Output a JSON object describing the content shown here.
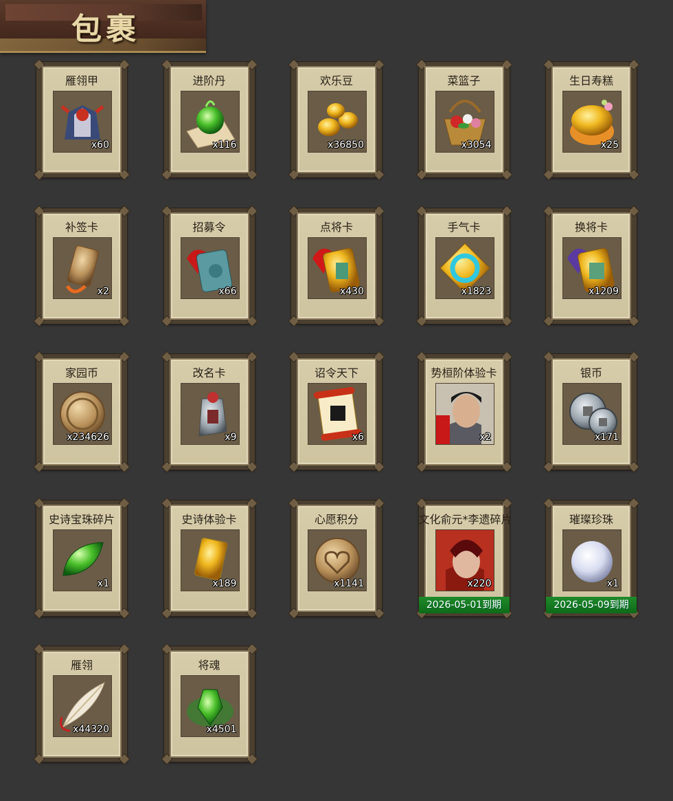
{
  "header": {
    "title": "包裹"
  },
  "items": [
    {
      "name": "雁翎甲",
      "qty": "x60",
      "icon": "armor-icon",
      "expire": ""
    },
    {
      "name": "进阶丹",
      "qty": "x116",
      "icon": "green-pill-icon",
      "expire": ""
    },
    {
      "name": "欢乐豆",
      "qty": "x36850",
      "icon": "gold-beans-icon",
      "expire": ""
    },
    {
      "name": "菜篮子",
      "qty": "x3054",
      "icon": "flower-basket-icon",
      "expire": ""
    },
    {
      "name": "生日寿糕",
      "qty": "x25",
      "icon": "birthday-cake-icon",
      "expire": ""
    },
    {
      "name": "补签卡",
      "qty": "x2",
      "icon": "bronze-tag-icon",
      "expire": ""
    },
    {
      "name": "招募令",
      "qty": "x66",
      "icon": "recruit-token-icon",
      "expire": ""
    },
    {
      "name": "点将卡",
      "qty": "x430",
      "icon": "general-card-icon",
      "expire": ""
    },
    {
      "name": "手气卡",
      "qty": "x1823",
      "icon": "luck-card-icon",
      "expire": ""
    },
    {
      "name": "换将卡",
      "qty": "x1209",
      "icon": "swap-card-icon",
      "expire": ""
    },
    {
      "name": "家园币",
      "qty": "x234626",
      "icon": "home-coin-icon",
      "expire": ""
    },
    {
      "name": "改名卡",
      "qty": "x9",
      "icon": "rename-tag-icon",
      "expire": ""
    },
    {
      "name": "诏令天下",
      "qty": "x6",
      "icon": "edict-scroll-icon",
      "expire": ""
    },
    {
      "name": "势桓阶体验卡",
      "qty": "x2",
      "icon": "hero-portrait-icon",
      "expire": ""
    },
    {
      "name": "银币",
      "qty": "x171",
      "icon": "silver-coins-icon",
      "expire": ""
    },
    {
      "name": "史诗宝珠碎片",
      "qty": "x1",
      "icon": "green-leaf-gem-icon",
      "expire": ""
    },
    {
      "name": "史诗体验卡",
      "qty": "x189",
      "icon": "gold-card-icon",
      "expire": ""
    },
    {
      "name": "心愿积分",
      "qty": "x1141",
      "icon": "heart-coin-icon",
      "expire": ""
    },
    {
      "name": "文化俞元*李遗碎片",
      "qty": "x220",
      "icon": "hero-fragment-icon",
      "expire": "2026-05-01到期"
    },
    {
      "name": "璀璨珍珠",
      "qty": "x1",
      "icon": "pearl-icon",
      "expire": "2026-05-09到期"
    },
    {
      "name": "雁翎",
      "qty": "x44320",
      "icon": "feather-icon",
      "expire": ""
    },
    {
      "name": "将魂",
      "qty": "x4501",
      "icon": "soul-crystal-icon",
      "expire": ""
    }
  ]
}
